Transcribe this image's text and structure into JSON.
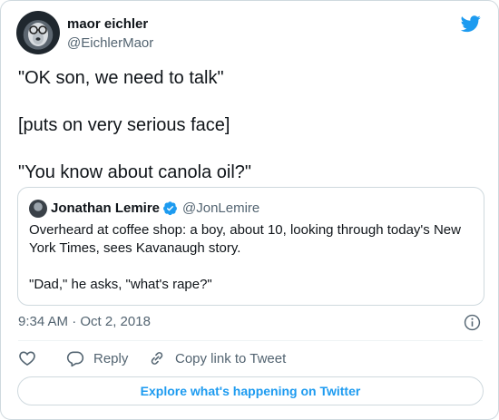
{
  "author": {
    "display_name": "maor eichler",
    "handle": "@EichlerMaor"
  },
  "tweet": {
    "lines": [
      "\"OK son, we need to talk\"",
      "[puts on very serious face]",
      "\"You know about canola oil?\""
    ],
    "timestamp": "9:34 AM · Oct 2, 2018"
  },
  "quoted": {
    "display_name": "Jonathan Lemire",
    "handle": "@JonLemire",
    "paragraphs": [
      "Overheard at coffee shop: a boy, about 10, looking through today's New York Times, sees Kavanaugh story.",
      "\"Dad,\" he asks, \"what's rape?\""
    ]
  },
  "actions": {
    "reply_label": "Reply",
    "copy_label": "Copy link to Tweet"
  },
  "footer": {
    "explore_label": "Explore what's happening on Twitter"
  },
  "icons": {
    "brand": "twitter-bird-icon",
    "verified": "verified-badge-icon",
    "like": "heart-icon",
    "reply": "speech-bubble-icon",
    "copy": "link-icon",
    "info": "info-icon"
  },
  "colors": {
    "brand_blue": "#1d9bf0",
    "text": "#0f1419",
    "muted": "#536471",
    "border": "#cfd9de"
  }
}
